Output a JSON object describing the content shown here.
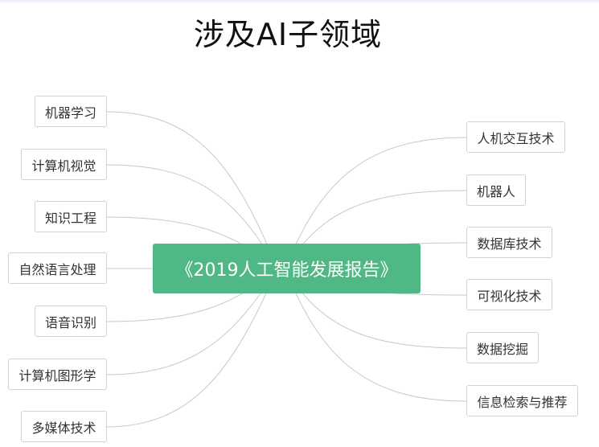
{
  "title": "涉及AI子领域",
  "center": "《2019人工智能发展报告》",
  "left_nodes": [
    "机器学习",
    "计算机视觉",
    "知识工程",
    "自然语言处理",
    "语音识别",
    "计算机图形学",
    "多媒体技术"
  ],
  "right_nodes": [
    "人机交互技术",
    "机器人",
    "数据库技术",
    "可视化技术",
    "数据挖掘",
    "信息检索与推荐"
  ],
  "colors": {
    "center_fill": "#4fb884",
    "node_border": "#d2d2d2",
    "link": "#c8c8c8"
  }
}
